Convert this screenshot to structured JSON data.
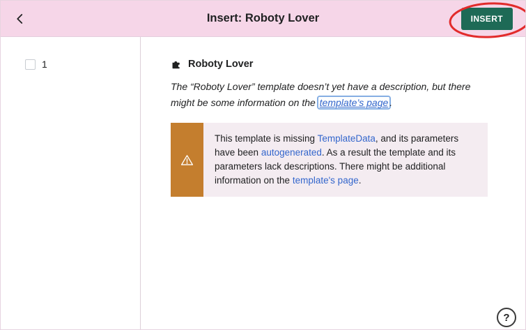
{
  "header": {
    "title": "Insert: Roboty Lover",
    "insert_button": "INSERT"
  },
  "sidebar": {
    "param_label": "1"
  },
  "panel": {
    "template_name": "Roboty Lover",
    "desc_text_1": "The “Roboty Lover” template doesn’t yet have a description, but there might be some information on the ",
    "desc_link": "template’s page",
    "desc_text_2": ".",
    "notice": {
      "t1": "This template is missing ",
      "link1": "TemplateData",
      "t2": ", and its parameters have been ",
      "link2": "autogenerated",
      "t3": ". As a result the template and its parameters lack descriptions. There might be additional information on the ",
      "link3": "template's page",
      "t4": "."
    }
  },
  "help": {
    "label": "?"
  },
  "colors": {
    "header_bg": "#f6d6e8",
    "insert_bg": "#1e6a56",
    "link_color": "#3366cc",
    "warning_orange": "#c47e2e",
    "notice_bg": "#f4ecf1",
    "annotation_red": "#e22b2b",
    "text_color": "#202122"
  }
}
